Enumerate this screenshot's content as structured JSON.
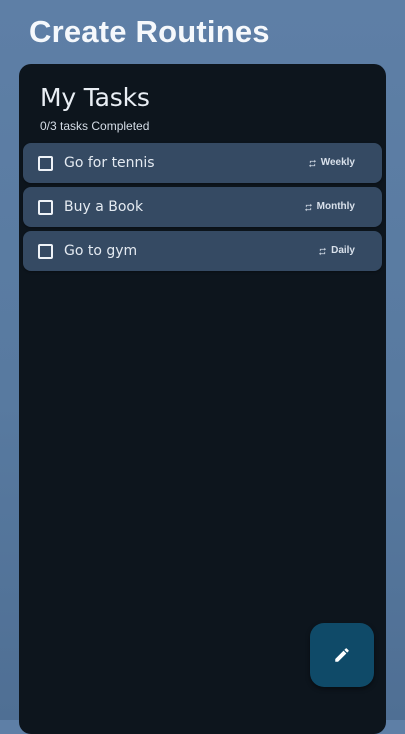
{
  "header": {
    "title": "Create Routines"
  },
  "card": {
    "title": "My Tasks",
    "subtitle": "0/3 tasks Completed"
  },
  "tasks": [
    {
      "label": "Go for tennis",
      "frequency": "Weekly",
      "checked": false,
      "icon": "repeat-icon"
    },
    {
      "label": "Buy a Book",
      "frequency": "Monthly",
      "checked": false,
      "icon": "repeat-icon"
    },
    {
      "label": "Go to gym",
      "frequency": "Daily",
      "checked": false,
      "icon": "repeat-icon"
    }
  ],
  "fab": {
    "icon": "pencil-icon"
  },
  "colors": {
    "background": "#5b7ca3",
    "card": "#0d151d",
    "task_row": "#354a63",
    "fab": "#0f4a68"
  }
}
